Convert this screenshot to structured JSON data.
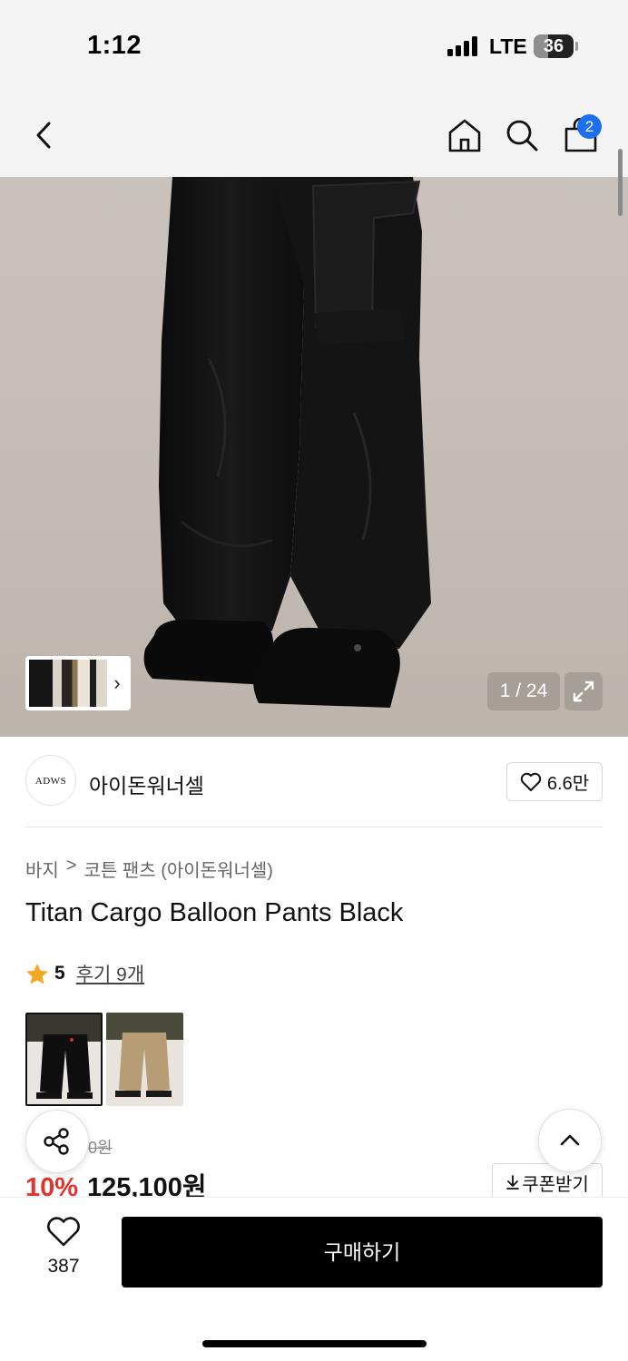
{
  "status_bar": {
    "time": "1:12",
    "network": "LTE",
    "battery": "36",
    "battery_level": 0.36
  },
  "nav": {
    "back_icon": "chevron-left-icon",
    "home_icon": "home-icon",
    "search_icon": "search-icon",
    "cart_icon": "shopping-bag-icon",
    "cart_count": "2"
  },
  "gallery": {
    "counter": "1 / 24",
    "expand_icon": "expand-icon",
    "thumb_chevron": "›"
  },
  "brand": {
    "logo_text": "ADWS",
    "name": "아이돈워너셀",
    "like_count": "6.6만"
  },
  "breadcrumb": {
    "category": "바지",
    "separator": ">",
    "subcategory": "코튼 팬츠 (아이돈워너셀)"
  },
  "product": {
    "title": "Titan Cargo Balloon Pants Black",
    "rating": "5",
    "reviews": "후기 9개",
    "original_price": "0원",
    "discount": "10%",
    "sale_price": "125,100원"
  },
  "colors": [
    "Black",
    "Beige"
  ],
  "coupon": {
    "label": "쿠폰받기"
  },
  "bottom": {
    "wish_count": "387",
    "buy_label": "구매하기"
  },
  "theme": {
    "accent_blue": "#1d6ff2",
    "discount_red": "#e5322d",
    "star": "#f5a623"
  }
}
